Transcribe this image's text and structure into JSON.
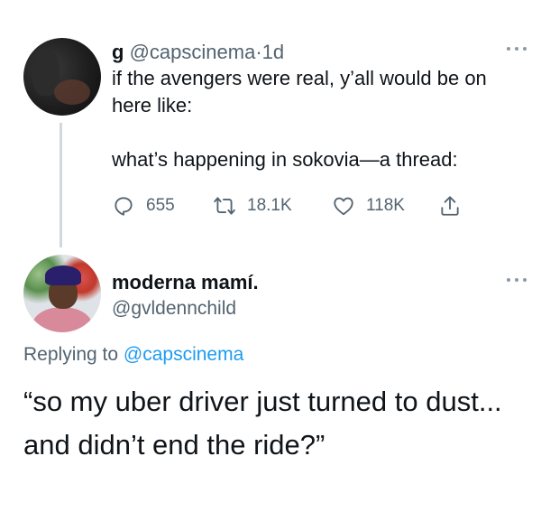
{
  "tweet": {
    "name": "g",
    "handle": "@capscinema",
    "separator": "·",
    "time": "1d",
    "text_line1": "if the avengers were real, y’all would be on here like:",
    "text_line2": "what’s happening in sokovia—a thread:",
    "counts": {
      "replies": "655",
      "retweets": "18.1K",
      "likes": "118K"
    }
  },
  "reply": {
    "name": "moderna mamí.",
    "handle": "@gvldennchild",
    "replying_prefix": "Replying to ",
    "replying_to": "@capscinema",
    "text": "“so my uber driver just turned to dust... and didn’t end the ride?”"
  },
  "colors": {
    "text": "#0f1419",
    "secondary": "#536471",
    "link": "#1d9bf0",
    "line": "#cfd9de"
  },
  "icons": [
    "reply-icon",
    "retweet-icon",
    "like-icon",
    "share-icon",
    "more-icon"
  ]
}
